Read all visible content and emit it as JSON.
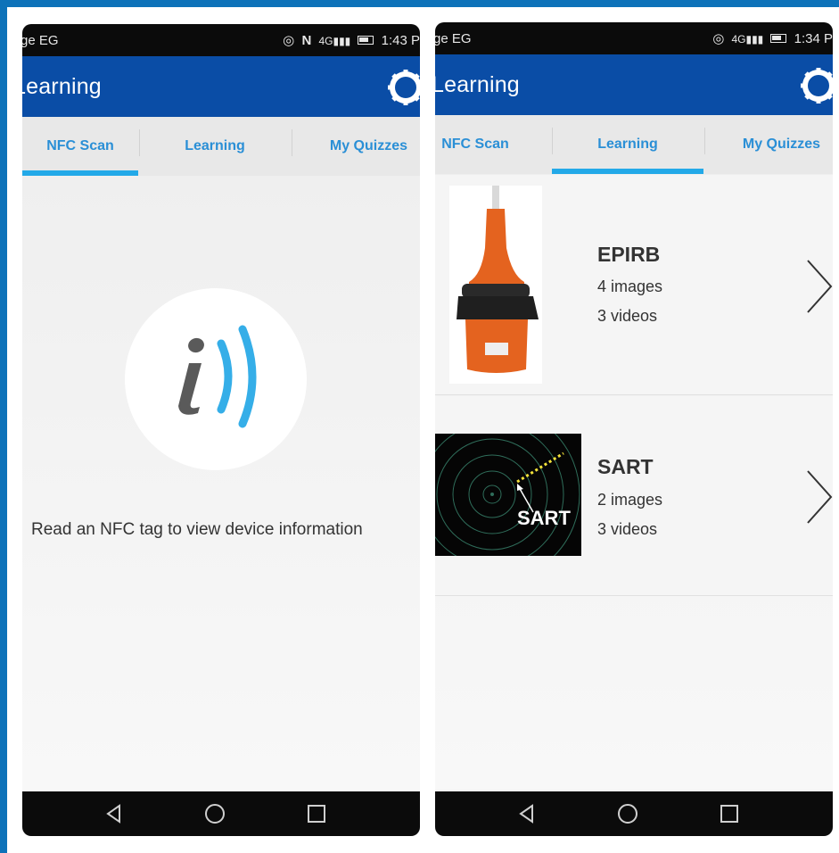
{
  "left": {
    "status": {
      "carrier": "ge EG",
      "time": "1:43 P"
    },
    "app_title": "Learning",
    "tabs": [
      {
        "label": "NFC Scan",
        "active": true
      },
      {
        "label": "Learning",
        "active": false
      },
      {
        "label": "My Quizzes",
        "active": false
      }
    ],
    "nfc_message": "Read an NFC tag to view device information"
  },
  "right": {
    "status": {
      "carrier": "ge EG",
      "time": "1:34 P"
    },
    "app_title": "Learning",
    "tabs": [
      {
        "label": "NFC Scan",
        "active": false
      },
      {
        "label": "Learning",
        "active": true
      },
      {
        "label": "My Quizzes",
        "active": false
      }
    ],
    "items": [
      {
        "name": "EPIRB",
        "images": "4 images",
        "videos": "3 videos",
        "thumbnail": "orange EPIRB beacon photo"
      },
      {
        "name": "SART",
        "images": "2 images",
        "videos": "3 videos",
        "thumbnail": "radar circles with SART label",
        "thumbnail_label": "SART"
      }
    ]
  },
  "icons": {
    "settings": "gear-icon",
    "nfc": "nfc-info-icon",
    "chevron": "chevron-right-icon",
    "nav_back": "back-triangle-icon",
    "nav_home": "home-circle-icon",
    "nav_recents": "recents-square-icon"
  },
  "colors": {
    "app_bar": "#0a4da6",
    "tab_text": "#2a8fd6",
    "tab_indicator": "#23a9e8",
    "frame": "#0d72b9",
    "nfc_blue": "#35aee8",
    "nfc_gray": "#5a5a5a",
    "epirb_orange": "#e4631f"
  }
}
